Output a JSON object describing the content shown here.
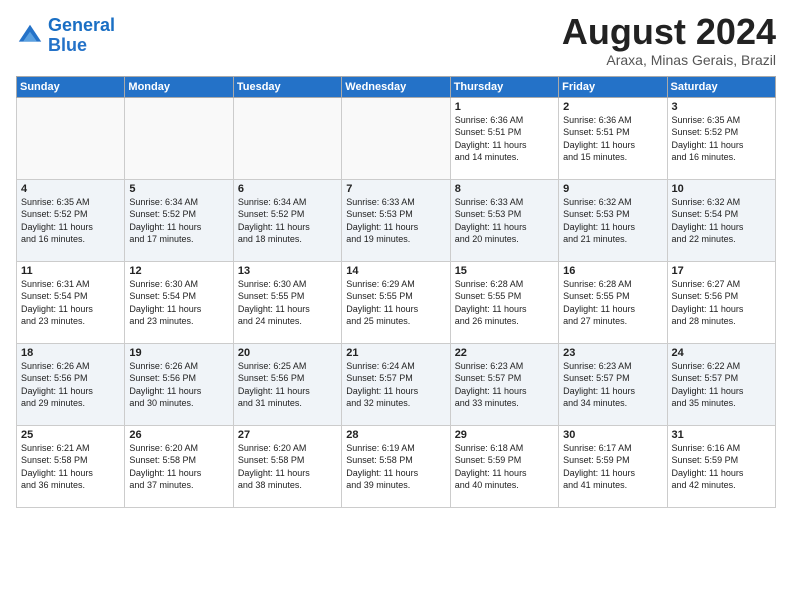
{
  "logo": {
    "line1": "General",
    "line2": "Blue"
  },
  "title": "August 2024",
  "subtitle": "Araxa, Minas Gerais, Brazil",
  "weekdays": [
    "Sunday",
    "Monday",
    "Tuesday",
    "Wednesday",
    "Thursday",
    "Friday",
    "Saturday"
  ],
  "weeks": [
    [
      {
        "day": "",
        "info": ""
      },
      {
        "day": "",
        "info": ""
      },
      {
        "day": "",
        "info": ""
      },
      {
        "day": "",
        "info": ""
      },
      {
        "day": "1",
        "info": "Sunrise: 6:36 AM\nSunset: 5:51 PM\nDaylight: 11 hours\nand 14 minutes."
      },
      {
        "day": "2",
        "info": "Sunrise: 6:36 AM\nSunset: 5:51 PM\nDaylight: 11 hours\nand 15 minutes."
      },
      {
        "day": "3",
        "info": "Sunrise: 6:35 AM\nSunset: 5:52 PM\nDaylight: 11 hours\nand 16 minutes."
      }
    ],
    [
      {
        "day": "4",
        "info": "Sunrise: 6:35 AM\nSunset: 5:52 PM\nDaylight: 11 hours\nand 16 minutes."
      },
      {
        "day": "5",
        "info": "Sunrise: 6:34 AM\nSunset: 5:52 PM\nDaylight: 11 hours\nand 17 minutes."
      },
      {
        "day": "6",
        "info": "Sunrise: 6:34 AM\nSunset: 5:52 PM\nDaylight: 11 hours\nand 18 minutes."
      },
      {
        "day": "7",
        "info": "Sunrise: 6:33 AM\nSunset: 5:53 PM\nDaylight: 11 hours\nand 19 minutes."
      },
      {
        "day": "8",
        "info": "Sunrise: 6:33 AM\nSunset: 5:53 PM\nDaylight: 11 hours\nand 20 minutes."
      },
      {
        "day": "9",
        "info": "Sunrise: 6:32 AM\nSunset: 5:53 PM\nDaylight: 11 hours\nand 21 minutes."
      },
      {
        "day": "10",
        "info": "Sunrise: 6:32 AM\nSunset: 5:54 PM\nDaylight: 11 hours\nand 22 minutes."
      }
    ],
    [
      {
        "day": "11",
        "info": "Sunrise: 6:31 AM\nSunset: 5:54 PM\nDaylight: 11 hours\nand 23 minutes."
      },
      {
        "day": "12",
        "info": "Sunrise: 6:30 AM\nSunset: 5:54 PM\nDaylight: 11 hours\nand 23 minutes."
      },
      {
        "day": "13",
        "info": "Sunrise: 6:30 AM\nSunset: 5:55 PM\nDaylight: 11 hours\nand 24 minutes."
      },
      {
        "day": "14",
        "info": "Sunrise: 6:29 AM\nSunset: 5:55 PM\nDaylight: 11 hours\nand 25 minutes."
      },
      {
        "day": "15",
        "info": "Sunrise: 6:28 AM\nSunset: 5:55 PM\nDaylight: 11 hours\nand 26 minutes."
      },
      {
        "day": "16",
        "info": "Sunrise: 6:28 AM\nSunset: 5:55 PM\nDaylight: 11 hours\nand 27 minutes."
      },
      {
        "day": "17",
        "info": "Sunrise: 6:27 AM\nSunset: 5:56 PM\nDaylight: 11 hours\nand 28 minutes."
      }
    ],
    [
      {
        "day": "18",
        "info": "Sunrise: 6:26 AM\nSunset: 5:56 PM\nDaylight: 11 hours\nand 29 minutes."
      },
      {
        "day": "19",
        "info": "Sunrise: 6:26 AM\nSunset: 5:56 PM\nDaylight: 11 hours\nand 30 minutes."
      },
      {
        "day": "20",
        "info": "Sunrise: 6:25 AM\nSunset: 5:56 PM\nDaylight: 11 hours\nand 31 minutes."
      },
      {
        "day": "21",
        "info": "Sunrise: 6:24 AM\nSunset: 5:57 PM\nDaylight: 11 hours\nand 32 minutes."
      },
      {
        "day": "22",
        "info": "Sunrise: 6:23 AM\nSunset: 5:57 PM\nDaylight: 11 hours\nand 33 minutes."
      },
      {
        "day": "23",
        "info": "Sunrise: 6:23 AM\nSunset: 5:57 PM\nDaylight: 11 hours\nand 34 minutes."
      },
      {
        "day": "24",
        "info": "Sunrise: 6:22 AM\nSunset: 5:57 PM\nDaylight: 11 hours\nand 35 minutes."
      }
    ],
    [
      {
        "day": "25",
        "info": "Sunrise: 6:21 AM\nSunset: 5:58 PM\nDaylight: 11 hours\nand 36 minutes."
      },
      {
        "day": "26",
        "info": "Sunrise: 6:20 AM\nSunset: 5:58 PM\nDaylight: 11 hours\nand 37 minutes."
      },
      {
        "day": "27",
        "info": "Sunrise: 6:20 AM\nSunset: 5:58 PM\nDaylight: 11 hours\nand 38 minutes."
      },
      {
        "day": "28",
        "info": "Sunrise: 6:19 AM\nSunset: 5:58 PM\nDaylight: 11 hours\nand 39 minutes."
      },
      {
        "day": "29",
        "info": "Sunrise: 6:18 AM\nSunset: 5:59 PM\nDaylight: 11 hours\nand 40 minutes."
      },
      {
        "day": "30",
        "info": "Sunrise: 6:17 AM\nSunset: 5:59 PM\nDaylight: 11 hours\nand 41 minutes."
      },
      {
        "day": "31",
        "info": "Sunrise: 6:16 AM\nSunset: 5:59 PM\nDaylight: 11 hours\nand 42 minutes."
      }
    ]
  ]
}
